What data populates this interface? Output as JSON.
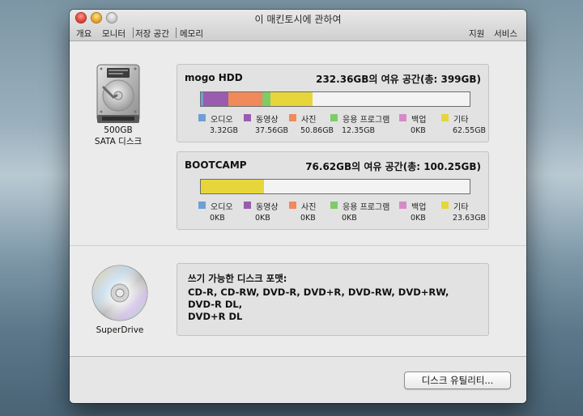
{
  "window": {
    "title": "이 매킨토시에 관하여",
    "tabs": [
      {
        "label": "개요"
      },
      {
        "label": "모니터"
      },
      {
        "label": "저장 공간"
      },
      {
        "label": "메모리"
      }
    ],
    "right_tabs": [
      {
        "label": "지원"
      },
      {
        "label": "서비스"
      }
    ]
  },
  "hdd": {
    "icon": "hard-drive-icon",
    "label_line1": "500GB",
    "label_line2": "SATA 디스크",
    "volumes": [
      {
        "name": "mogo HDD",
        "free_text": "232.36GB의 여유 공간",
        "total_text": "(총: 399GB)",
        "capacity_gb": 399,
        "used": [
          {
            "category": "audio",
            "gb": 3.32
          },
          {
            "category": "movies",
            "gb": 37.56
          },
          {
            "category": "photos",
            "gb": 50.86
          },
          {
            "category": "apps",
            "gb": 12.35
          },
          {
            "category": "backups",
            "gb": 0
          },
          {
            "category": "other",
            "gb": 62.55
          }
        ],
        "legend": [
          {
            "label": "오디오",
            "value": "3.32GB"
          },
          {
            "label": "동영상",
            "value": "37.56GB"
          },
          {
            "label": "사진",
            "value": "50.86GB"
          },
          {
            "label": "응용 프로그램",
            "value": "12.35GB"
          },
          {
            "label": "백업",
            "value": "0KB"
          },
          {
            "label": "기타",
            "value": "62.55GB"
          }
        ]
      },
      {
        "name": "BOOTCAMP",
        "free_text": "76.62GB의 여유 공간",
        "total_text": "(총: 100.25GB)",
        "capacity_gb": 100.25,
        "used": [
          {
            "category": "audio",
            "gb": 0
          },
          {
            "category": "movies",
            "gb": 0
          },
          {
            "category": "photos",
            "gb": 0
          },
          {
            "category": "apps",
            "gb": 0
          },
          {
            "category": "backups",
            "gb": 0
          },
          {
            "category": "other",
            "gb": 23.63
          }
        ],
        "legend": [
          {
            "label": "오디오",
            "value": "0KB"
          },
          {
            "label": "동영상",
            "value": "0KB"
          },
          {
            "label": "사진",
            "value": "0KB"
          },
          {
            "label": "응용 프로그램",
            "value": "0KB"
          },
          {
            "label": "백업",
            "value": "0KB"
          },
          {
            "label": "기타",
            "value": "23.63GB"
          }
        ]
      }
    ]
  },
  "colors": {
    "audio": "#6f9fd6",
    "movies": "#9a5cae",
    "photos": "#f08a5a",
    "apps": "#7fcb68",
    "backups": "#d68ac8",
    "other": "#e6d63c"
  },
  "superdrive": {
    "icon": "optical-disc-icon",
    "label": "SuperDrive",
    "formats_title": "쓰기 가능한 디스크 포맷:",
    "formats_line1": "CD-R, CD-RW, DVD-R, DVD+R, DVD-RW, DVD+RW, DVD-R DL,",
    "formats_line2": "DVD+R DL"
  },
  "button": {
    "label": "디스크 유틸리티..."
  }
}
